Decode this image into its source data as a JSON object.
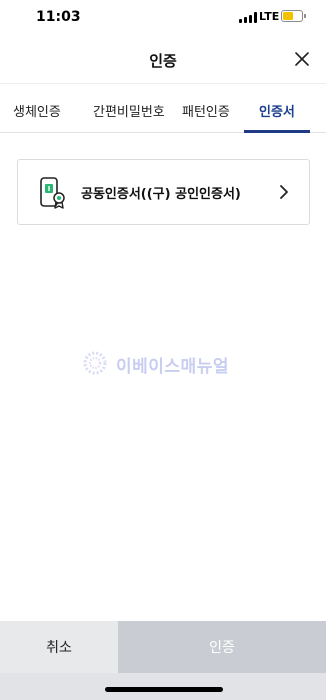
{
  "status_bar": {
    "time": "11:03",
    "network": "LTE",
    "battery_color": "#f2c200"
  },
  "header": {
    "title": "인증",
    "close_icon": "close-icon"
  },
  "tabs": [
    {
      "label": "생체인증",
      "active": false
    },
    {
      "label": "간편비밀번호",
      "active": false
    },
    {
      "label": "패턴인증",
      "active": false
    },
    {
      "label": "인증서",
      "active": true
    }
  ],
  "cert_list": [
    {
      "label": "공동인증서((구) 공인인증서)",
      "icon": "certificate-phone-icon",
      "chevron": "chevron-right-icon"
    }
  ],
  "watermark": {
    "text": "이베이스매뉴얼"
  },
  "footer": {
    "cancel_label": "취소",
    "confirm_label": "인증"
  },
  "colors": {
    "accent": "#1f3b86",
    "cert_icon_green": "#2bb673",
    "confirm_disabled": "#c9ccd2"
  }
}
